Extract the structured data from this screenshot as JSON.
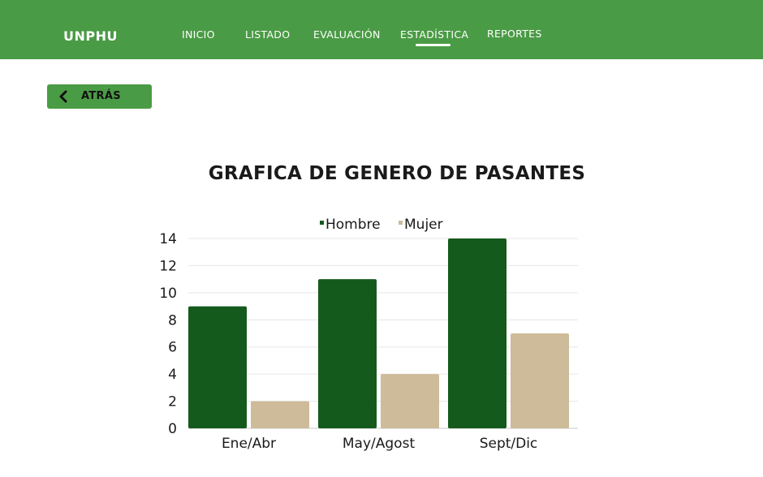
{
  "header": {
    "brand": "UNPHU",
    "nav": [
      {
        "label": "INICIO",
        "active": false
      },
      {
        "label": "LISTADO",
        "active": false
      },
      {
        "label": "EVALUACIÓN",
        "active": false
      },
      {
        "label": "ESTADÍSTICA",
        "active": true
      },
      {
        "label": "REPORTES",
        "active": false
      }
    ]
  },
  "back_button": {
    "label": "ATRÁS",
    "icon": "chevron-left-icon"
  },
  "colors": {
    "topbar": "#4a9b45",
    "hombre": "#145a1c",
    "mujer": "#cdbb99"
  },
  "chart_data": {
    "type": "bar",
    "title": "GRAFICA DE GENERO DE PASANTES",
    "categories": [
      "Ene/Abr",
      "May/Agost",
      "Sept/Dic"
    ],
    "series": [
      {
        "name": "Hombre",
        "values": [
          9,
          11,
          14
        ]
      },
      {
        "name": "Mujer",
        "values": [
          2,
          4,
          7
        ]
      }
    ],
    "yticks": [
      0,
      2,
      4,
      6,
      8,
      10,
      12,
      14
    ],
    "ylim": [
      0,
      14
    ],
    "grid": true,
    "legend": "top"
  }
}
